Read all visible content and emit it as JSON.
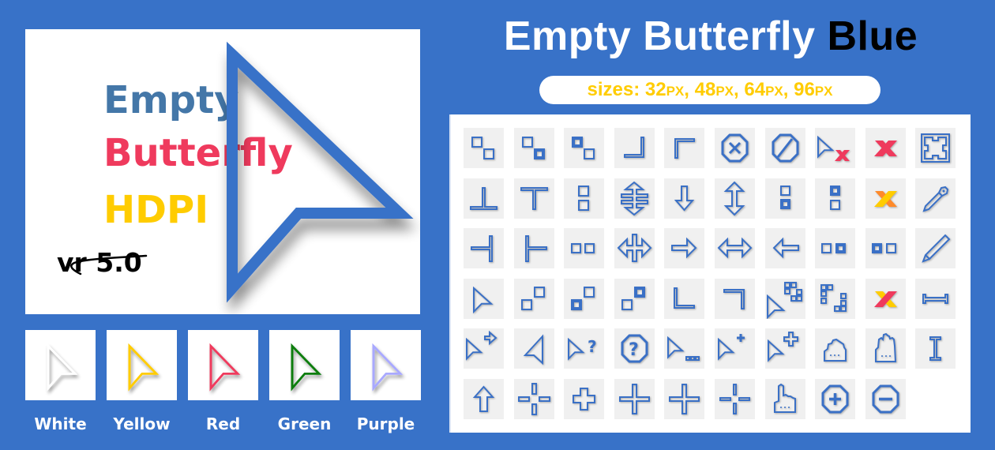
{
  "hero": {
    "line1": "Empty",
    "line2": "Butterfly",
    "line3": "HDPI",
    "version": "vr 5.0",
    "colors": {
      "line1": "#4477a8",
      "line2": "#ef3a5d",
      "line3": "#ffcc00",
      "cursor": "#3872c8"
    }
  },
  "variants": [
    {
      "label": "White",
      "color": "#ffffff"
    },
    {
      "label": "Yellow",
      "color": "#ffcc00"
    },
    {
      "label": "Red",
      "color": "#ef3a5d"
    },
    {
      "label": "Green",
      "color": "#0a7d10"
    },
    {
      "label": "Purple",
      "color": "#a9a9ff"
    }
  ],
  "title": {
    "main": "Empty Butterfly",
    "accent": "Blue"
  },
  "sizes": {
    "prefix": "sizes: ",
    "values": [
      "32",
      "48",
      "64",
      "96"
    ],
    "unit": "PX"
  },
  "theme": {
    "background": "#3872c8",
    "icon": "#3a70c6",
    "cell": "#f0f0f0"
  },
  "cursors": [
    [
      "resize-nw-se-squares-icon",
      "resize-nw-se-bottom-filled-icon",
      "resize-nw-se-top-filled-icon",
      "corner-bottom-right-icon",
      "corner-top-left-icon",
      "not-allowed-octagon-x-icon",
      "no-circle-slash-icon",
      "pointer-x-icon",
      "red-x-icon",
      "fullscreen-icon"
    ],
    [
      "bottom-tee-icon",
      "top-tee-icon",
      "resize-vertical-squares-icon",
      "row-resize-icon",
      "arrow-down-icon",
      "resize-vertical-icon",
      "resize-vertical-bottom-filled-icon",
      "resize-vertical-top-filled-icon",
      "yellow-x-icon",
      "eyedropper-icon"
    ],
    [
      "right-tee-icon",
      "left-tee-icon",
      "resize-horizontal-squares-icon",
      "col-resize-icon",
      "arrow-right-icon",
      "resize-horizontal-icon",
      "arrow-left-icon",
      "resize-horizontal-right-filled-icon",
      "resize-horizontal-left-filled-icon",
      "pencil-icon"
    ],
    [
      "pointer-icon",
      "resize-ne-sw-squares-icon",
      "resize-ne-sw-bottom-filled-icon",
      "resize-ne-sw-top-filled-icon",
      "corner-bottom-left-icon",
      "corner-top-right-icon",
      "pointer-select-icon",
      "select-squares-icon",
      "red-yellow-x-icon",
      "resize-span-icon"
    ],
    [
      "pointer-alias-icon",
      "pointer-left-icon",
      "pointer-help-icon",
      "help-octagon-icon",
      "pointer-progress-icon",
      "pointer-plus-icon",
      "pointer-move-icon",
      "grab-hand-icon",
      "open-hand-icon",
      "text-ibeam-icon"
    ],
    [
      "arrow-up-icon",
      "crosshair-gap-icon",
      "cross-icon",
      "thin-cross-icon",
      "cross-large-icon",
      "crosshair-icon",
      "pointing-hand-icon",
      "zoom-in-octagon-icon",
      "zoom-out-octagon-icon"
    ]
  ]
}
